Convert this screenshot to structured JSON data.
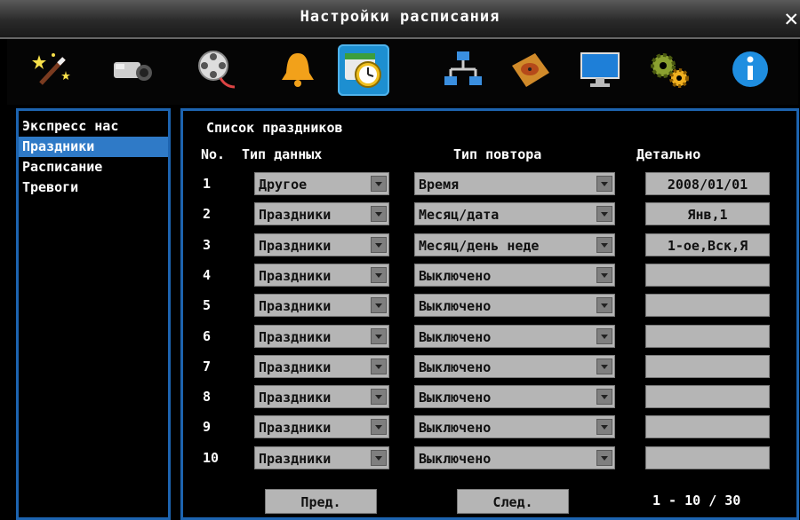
{
  "window": {
    "title": "Настройки расписания",
    "close": "✕"
  },
  "toolbar": {
    "icons": [
      "wand-icon",
      "camera-icon",
      "film-reel-icon",
      "bell-icon",
      "schedule-clock-icon",
      "network-icon",
      "hard-disk-icon",
      "monitor-icon",
      "gears-icon",
      "info-icon"
    ],
    "active_index": 4
  },
  "sidebar": {
    "items": [
      "Экспресс нас",
      "Праздники",
      "Расписание",
      "Тревоги"
    ],
    "selected_index": 1
  },
  "main": {
    "title": "Список праздников",
    "col_no": "No.",
    "col_type": "Тип данных",
    "col_repeat": "Тип повтора",
    "col_detail": "Детально",
    "rows": [
      {
        "no": "1",
        "type": "Другое",
        "repeat": "Время",
        "detail": "2008/01/01"
      },
      {
        "no": "2",
        "type": "Праздники",
        "repeat": "Месяц/дата",
        "detail": "Янв,1"
      },
      {
        "no": "3",
        "type": "Праздники",
        "repeat": "Месяц/день неде",
        "detail": "1-ое,Вск,Я"
      },
      {
        "no": "4",
        "type": "Праздники",
        "repeat": "Выключено",
        "detail": ""
      },
      {
        "no": "5",
        "type": "Праздники",
        "repeat": "Выключено",
        "detail": ""
      },
      {
        "no": "6",
        "type": "Праздники",
        "repeat": "Выключено",
        "detail": ""
      },
      {
        "no": "7",
        "type": "Праздники",
        "repeat": "Выключено",
        "detail": ""
      },
      {
        "no": "8",
        "type": "Праздники",
        "repeat": "Выключено",
        "detail": ""
      },
      {
        "no": "9",
        "type": "Праздники",
        "repeat": "Выключено",
        "detail": ""
      },
      {
        "no": "10",
        "type": "Праздники",
        "repeat": "Выключено",
        "detail": ""
      }
    ],
    "prev_label": "Пред.",
    "next_label": "След.",
    "page_info": "1 - 10 / 30"
  }
}
